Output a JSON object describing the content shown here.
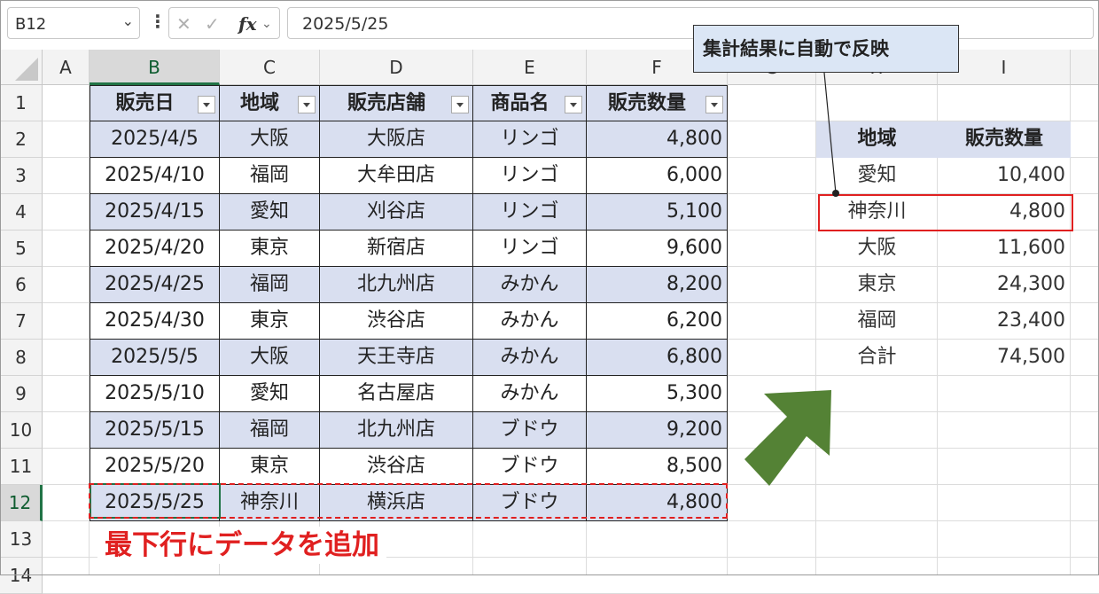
{
  "formula_bar": {
    "name_box": "B12",
    "fx_label": "fx",
    "formula_value": "2025/5/25"
  },
  "columns": [
    "A",
    "B",
    "C",
    "D",
    "E",
    "F",
    "G",
    "H",
    "I"
  ],
  "rows": [
    "1",
    "2",
    "3",
    "4",
    "5",
    "6",
    "7",
    "8",
    "9",
    "10",
    "11",
    "12",
    "13",
    "14"
  ],
  "table": {
    "headers": [
      "販売日",
      "地域",
      "販売店舗",
      "商品名",
      "販売数量"
    ],
    "rows": [
      [
        "2025/4/5",
        "大阪",
        "大阪店",
        "リンゴ",
        "4,800"
      ],
      [
        "2025/4/10",
        "福岡",
        "大牟田店",
        "リンゴ",
        "6,000"
      ],
      [
        "2025/4/15",
        "愛知",
        "刈谷店",
        "リンゴ",
        "5,100"
      ],
      [
        "2025/4/20",
        "東京",
        "新宿店",
        "リンゴ",
        "9,600"
      ],
      [
        "2025/4/25",
        "福岡",
        "北九州店",
        "みかん",
        "8,200"
      ],
      [
        "2025/4/30",
        "東京",
        "渋谷店",
        "みかん",
        "6,200"
      ],
      [
        "2025/5/5",
        "大阪",
        "天王寺店",
        "みかん",
        "6,800"
      ],
      [
        "2025/5/10",
        "愛知",
        "名古屋店",
        "みかん",
        "5,300"
      ],
      [
        "2025/5/15",
        "福岡",
        "北九州店",
        "ブドウ",
        "9,200"
      ],
      [
        "2025/5/20",
        "東京",
        "渋谷店",
        "ブドウ",
        "8,500"
      ],
      [
        "2025/5/25",
        "神奈川",
        "横浜店",
        "ブドウ",
        "4,800"
      ]
    ]
  },
  "summary": {
    "headers": [
      "地域",
      "販売数量"
    ],
    "rows": [
      [
        "愛知",
        "10,400"
      ],
      [
        "神奈川",
        "4,800"
      ],
      [
        "大阪",
        "11,600"
      ],
      [
        "東京",
        "24,300"
      ],
      [
        "福岡",
        "23,400"
      ],
      [
        "合計",
        "74,500"
      ]
    ]
  },
  "annotations": {
    "callout": "集計結果に自動で反映",
    "add_label": "最下行にデータを追加"
  },
  "colors": {
    "band": "#d9dff0",
    "highlight_red": "#e02020",
    "arrow_green": "#548235",
    "excel_green": "#217346"
  }
}
